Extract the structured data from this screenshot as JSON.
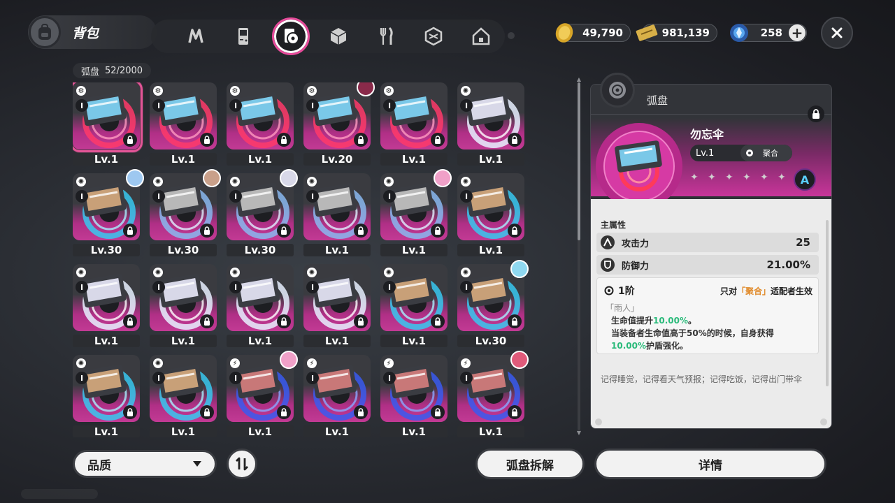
{
  "header": {
    "title": "背包",
    "tabs": [
      {
        "icon": "nuclear-icon"
      },
      {
        "icon": "gameboy-icon"
      },
      {
        "icon": "disc-book-icon",
        "active": true
      },
      {
        "icon": "cube-icon"
      },
      {
        "icon": "fork-knife-icon"
      },
      {
        "icon": "cube-outline-icon"
      },
      {
        "icon": "house-icon"
      }
    ]
  },
  "currencies": [
    {
      "icon": "gold-coin-icon",
      "value": "49,790"
    },
    {
      "icon": "ticket-icon",
      "value": "981,139"
    },
    {
      "icon": "crystal-icon",
      "value": "258"
    }
  ],
  "inventory": {
    "label": "弧盘",
    "count": "52/2000"
  },
  "grid": {
    "items": [
      {
        "level": "Lv.1",
        "theme": "pink",
        "avatar": null,
        "selected": true
      },
      {
        "level": "Lv.1",
        "theme": "pink",
        "avatar": null
      },
      {
        "level": "Lv.1",
        "theme": "pink",
        "avatar": null
      },
      {
        "level": "Lv.20",
        "theme": "pink",
        "avatar": "#8a2a4a"
      },
      {
        "level": "Lv.1",
        "theme": "pink",
        "avatar": null
      },
      {
        "level": "Lv.1",
        "theme": "white",
        "avatar": null
      },
      {
        "level": "Lv.30",
        "theme": "cyan",
        "avatar": "#9ec8f0"
      },
      {
        "level": "Lv.30",
        "theme": "silver",
        "avatar": "#c9a08a"
      },
      {
        "level": "Lv.30",
        "theme": "silver",
        "avatar": "#d8d8e8"
      },
      {
        "level": "Lv.1",
        "theme": "silver",
        "avatar": null
      },
      {
        "level": "Lv.1",
        "theme": "silver",
        "avatar": "#f0a0c8"
      },
      {
        "level": "Lv.1",
        "theme": "cyan",
        "avatar": null
      },
      {
        "level": "Lv.1",
        "theme": "white",
        "avatar": null
      },
      {
        "level": "Lv.1",
        "theme": "white",
        "avatar": null
      },
      {
        "level": "Lv.1",
        "theme": "white",
        "avatar": null
      },
      {
        "level": "Lv.1",
        "theme": "white",
        "avatar": null
      },
      {
        "level": "Lv.1",
        "theme": "cyan",
        "avatar": null
      },
      {
        "level": "Lv.30",
        "theme": "cyan",
        "avatar": "#8fd8f0"
      },
      {
        "level": "Lv.1",
        "theme": "cyan",
        "avatar": null
      },
      {
        "level": "Lv.1",
        "theme": "cyan",
        "avatar": null
      },
      {
        "level": "Lv.1",
        "theme": "blue",
        "avatar": "#f0a0c8"
      },
      {
        "level": "Lv.1",
        "theme": "blue",
        "avatar": null
      },
      {
        "level": "Lv.1",
        "theme": "blue",
        "avatar": null
      },
      {
        "level": "Lv.1",
        "theme": "blue",
        "avatar": "#e05a7a"
      }
    ]
  },
  "bottom": {
    "filter_label": "品质",
    "dismantle_label": "弧盘拆解",
    "details_label": "详情"
  },
  "detail": {
    "category": "弧盘",
    "name": "勿忘伞",
    "level": "Lv.1",
    "attribute": "聚合",
    "grade": "A",
    "main_stats_title": "主属性",
    "stats": [
      {
        "icon": "attack-icon",
        "name": "攻击力",
        "value": "25"
      },
      {
        "icon": "defense-icon",
        "name": "防御力",
        "value": "21.00%"
      }
    ],
    "tier": "1阶",
    "tier_note_prefix": "只对",
    "tier_note_highlight": "「聚合」",
    "tier_note_suffix": "适配者生效",
    "skill_title": "「雨人」",
    "skill_line1_a": "生命值提升",
    "skill_line1_b": "10.00%",
    "skill_line1_c": "。",
    "skill_line2": "当装备者生命值高于50%的时候，自身获得",
    "skill_line3_a": "10.00%",
    "skill_line3_b": "护盾强化。",
    "flavor": "记得睡觉，记得看天气预报；记得吃饭，记得出门带伞"
  },
  "colors": {
    "accent_pink": "#e25596",
    "highlight_orange": "#e08a2a",
    "highlight_green": "#2aba7a"
  }
}
